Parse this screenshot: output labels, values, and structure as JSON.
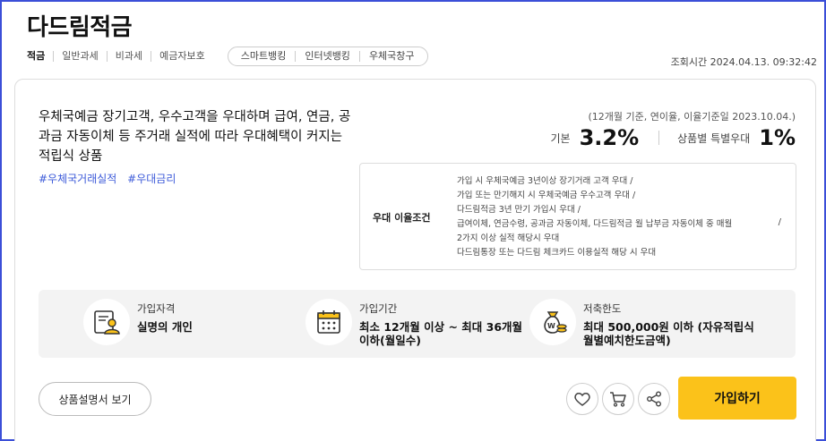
{
  "product": {
    "title": "다드림적금",
    "tags": [
      "적금",
      "일반과세",
      "비과세",
      "예금자보호"
    ],
    "channels": [
      "스마트뱅킹",
      "인터넷뱅킹",
      "우체국창구"
    ],
    "lookup_time": "조회시간 2024.04.13. 09:32:42"
  },
  "summary": {
    "description": "우체국예금 장기고객, 우수고객을 우대하며 급여, 연금, 공과금 자동이체 등 주거래 실적에 따라 우대혜택이 커지는 적립식 상품",
    "hashtags": [
      "#우체국거래실적",
      "#우대금리"
    ],
    "rate_basis": "(12개월 기준, 연이율, 이율기준일 2023.10.04.)",
    "base_rate_label": "기본",
    "base_rate": "3.2%",
    "special_rate_label": "상품별 특별우대",
    "special_rate": "1%"
  },
  "conditions": {
    "title": "우대 이율조건",
    "items": [
      "가입 시 우체국예금 3년이상 장기거래 고객 우대  /",
      "가입 또는 만기해지 시 우체국예금 우수고객 우대  /",
      "다드림적금 3년 만기 가입시 우대  /",
      "급여이체, 연금수령, 공과금 자동이체, 다드림적금 월 납부금 자동이체 중 매월",
      "2가지 이상 실적 해당시 우대",
      "다드림통장 또는 다드림 체크카드 이용실적 해당 시 우대"
    ],
    "trailing_slash": "/"
  },
  "info": [
    {
      "icon": "person-document-icon",
      "label": "가입자격",
      "value": "실명의 개인"
    },
    {
      "icon": "calendar-icon",
      "label": "가입기간",
      "value": "최소 12개월 이상 ~ 최대 36개월 이하(월일수)"
    },
    {
      "icon": "money-bag-icon",
      "label": "저축한도",
      "value": "최대 500,000원 이하 (자유적립식월별예치한도금액)"
    }
  ],
  "actions": {
    "doc_button": "상품설명서 보기",
    "join_button": "가입하기"
  },
  "colors": {
    "accent": "#fbc21a",
    "hashtag": "#3d5bd9",
    "frame": "#3b4fd8"
  }
}
